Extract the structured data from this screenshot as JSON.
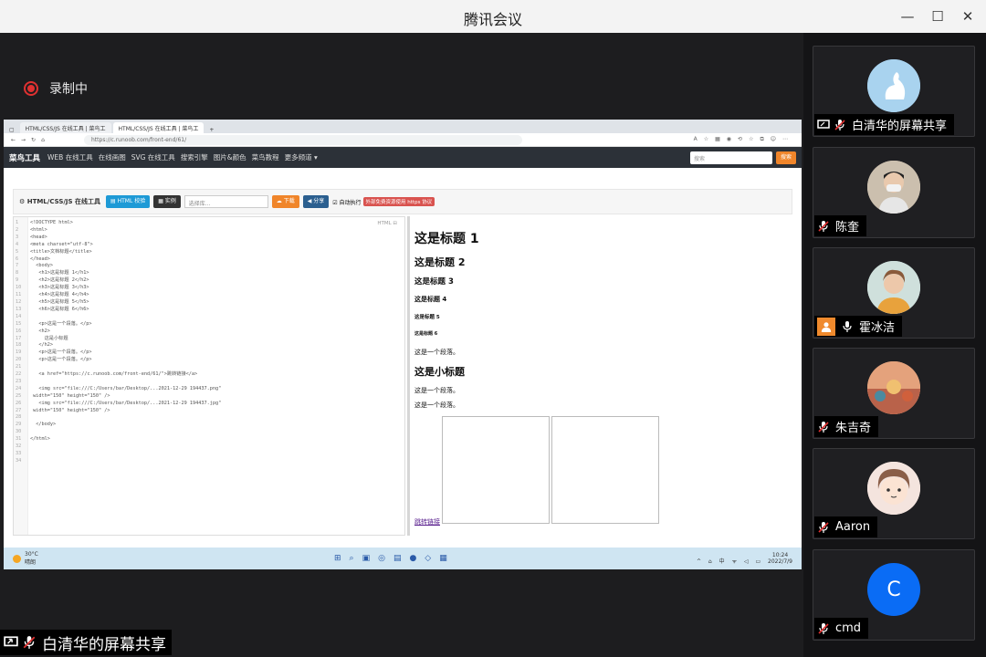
{
  "window": {
    "title": "腾讯会议"
  },
  "recording": {
    "label": "录制中"
  },
  "shared_screen": {
    "browser_tabs": [
      "HTML/CSS/JS 在线工具 | 菜鸟工",
      "HTML/CSS/JS 在线工具 | 菜鸟工"
    ],
    "url": "https://c.runoob.com/front-end/61/",
    "site_nav": {
      "brand": "菜鸟工具",
      "items": [
        "WEB 在线工具",
        "在线画图",
        "SVG 在线工具",
        "搜索引擎",
        "图片&颜色",
        "菜鸟教程",
        "更多频道 ▾"
      ],
      "search_placeholder": "搜索",
      "search_button": "搜索"
    },
    "toolbar": {
      "title": "⚙ HTML/CSS/JS 在线工具",
      "btn_html": "▤ HTML 校验",
      "btn_example": "▦ 实例",
      "select": "选择库...",
      "btn_download": "☁ 下载",
      "btn_share": "◀ 分享",
      "autorun": "☑ 自动执行",
      "badge": "外部免费资源使用 https 协议"
    },
    "editor": {
      "lang_tag": "HTML ⊟",
      "line_numbers": "1\n2\n3\n4\n5\n6\n7\n8\n9\n10\n11\n12\n13\n14\n15\n16\n17\n18\n19\n20\n21\n22\n23\n24\n25\n26\n27\n28\n29\n30\n31\n32\n33\n34",
      "code": "<!DOCTYPE html>\n<html>\n<head>\n<meta charset=\"utf-8\">\n<title>文档标题</title>\n</head>\n  <body>\n   <h1>这是标题 1</h1>\n   <h2>这是标题 2</h2>\n   <h3>这是标题 3</h3>\n   <h4>这是标题 4</h4>\n   <h5>这是标题 5</h5>\n   <h6>这是标题 6</h6>\n\n   <p>这是一个段落。</p>\n   <h2>\n     这是小标题\n   </h2>\n   <p>这是一个段落。</p>\n   <p>这是一个段落。</p>\n\n   <a href=\"https://c.runoob.com/front-end/61/\">跳转链接</a>\n\n   <img src=\"file:///C:/Users/bar/Desktop/...2021-12-29 194437.png\"\n width=\"150\" height=\"150\" />\n   <img src=\"file:///C:/Users/bar/Desktop/...2021-12-29 194437.jpg\"\n width=\"150\" height=\"150\" />\n\n  </body>\n\n</html>"
    },
    "preview": {
      "h1": "这是标题 1",
      "h2": "这是标题 2",
      "h3": "这是标题 3",
      "h4": "这是标题 4",
      "h5": "这是标题 5",
      "h6": "这是标题 6",
      "p1": "这是一个段落。",
      "subtitle": "这是小标题",
      "p2": "这是一个段落。",
      "p3": "这是一个段落。",
      "link": "跳转链接"
    },
    "taskbar": {
      "weather_temp": "30°C",
      "weather_desc": "晴朗",
      "time": "10:24",
      "date": "2022/7/9",
      "lang": "中"
    }
  },
  "share_label": "白清华的屏幕共享",
  "participants": [
    {
      "name": "白清华的屏幕共享",
      "avatar": "swan-avatar"
    },
    {
      "name": "陈奎",
      "avatar": "photo-avatar"
    },
    {
      "name": "霍冰洁",
      "avatar": "photo-avatar"
    },
    {
      "name": "朱吉奇",
      "avatar": "photo-avatar"
    },
    {
      "name": "Aaron",
      "avatar": "cartoon-avatar"
    },
    {
      "name": "cmd",
      "avatar": "C"
    }
  ],
  "colors": {
    "accent_blue": "#0a6cf5",
    "record_red": "#e03131",
    "share_orange": "#f08a2d"
  }
}
